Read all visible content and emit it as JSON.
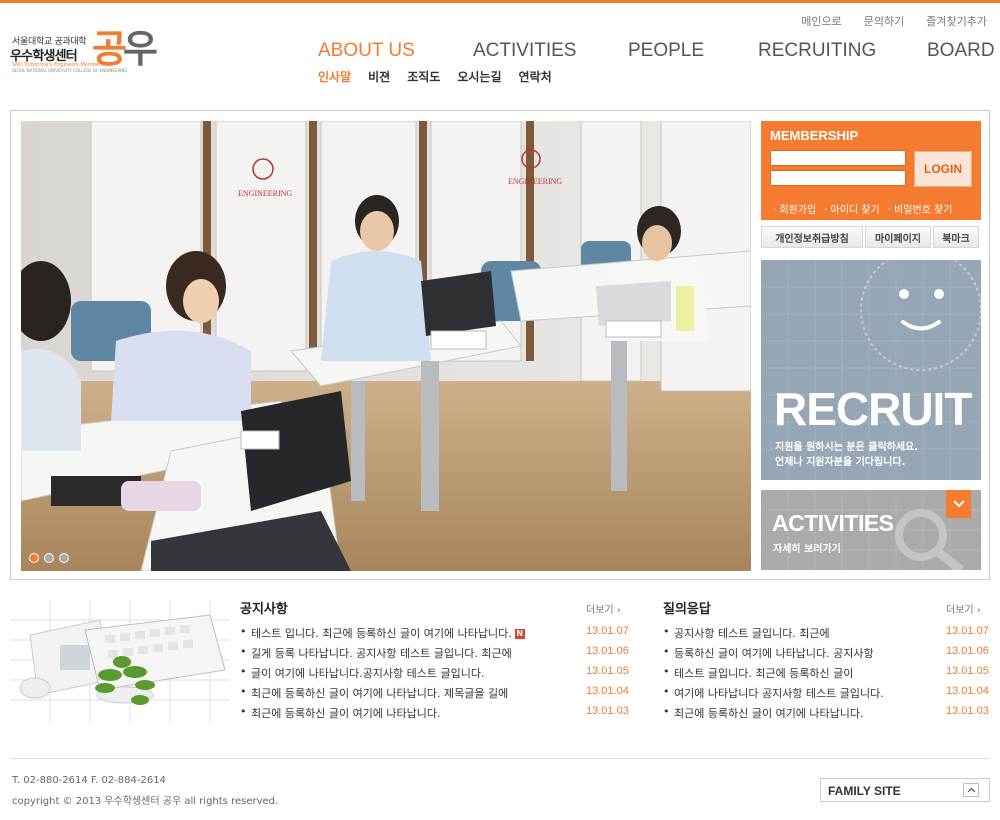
{
  "header": {
    "logo": {
      "line_small": "서울대학교 공과대학",
      "line_main": "우수학생센터",
      "line_en1": "SNU Tomorrow's Engineers Membership",
      "line_en2": "SEOUL NATIONAL UNIVERSITY COLLEGE OF ENGINEERING",
      "big_char1": "공",
      "big_char2": "우"
    },
    "util_links": [
      "메인으로",
      "문의하기",
      "즐겨찾기추가"
    ],
    "nav": [
      {
        "label": "ABOUT US",
        "active": true
      },
      {
        "label": "ACTIVITIES",
        "active": false
      },
      {
        "label": "PEOPLE",
        "active": false
      },
      {
        "label": "RECRUITING",
        "active": false
      },
      {
        "label": "BOARD",
        "active": false
      }
    ],
    "subnav": [
      {
        "label": "인사말",
        "active": true
      },
      {
        "label": "비젼",
        "active": false
      },
      {
        "label": "조직도",
        "active": false
      },
      {
        "label": "오시는길",
        "active": false
      },
      {
        "label": "연락처",
        "active": false
      }
    ]
  },
  "visual": {
    "signs": [
      "ENGINEERING",
      "ENGINEERING"
    ],
    "dots_count": 3,
    "active_dot": 0
  },
  "membership": {
    "title": "MEMBERSHIP",
    "id_value": "",
    "pw_value": "",
    "login_label": "LOGIN",
    "links": [
      "· 회원가입",
      "· 아이디 찾기",
      "· 비밀번호 찾기"
    ]
  },
  "quick_links": [
    "개인정보취급방침",
    "마이페이지",
    "북마크"
  ],
  "recruit_banner": {
    "title": "RECRUIT",
    "desc1": "지원을 원하시는 분은 클릭하세요.",
    "desc2": "언제나 지원자분을 기다립니다."
  },
  "activities_banner": {
    "title": "ACTIVITIES",
    "desc": "자세히 보러가기"
  },
  "notice": {
    "title": "공지사항",
    "more": "더보기 ›",
    "items": [
      {
        "subject": "테스트 입니다. 최근에 등록하신 글이 여기에 나타납니다.",
        "date": "13.01.07",
        "new": true
      },
      {
        "subject": "길게 등록 나타납니다. 공지사항 테스트 글입니다. 최근에",
        "date": "13.01.06",
        "new": false
      },
      {
        "subject": "글이 여기에 나타납니다.공지사항 테스트 글입니다.",
        "date": "13.01.05",
        "new": false
      },
      {
        "subject": "최근에 등록하신 글이 여기에 나타납니다. 제목글을 길에",
        "date": "13.01.04",
        "new": false
      },
      {
        "subject": "최근에 등록하신 글이 여기에 나타납니다.",
        "date": "13.01.03",
        "new": false
      }
    ],
    "new_badge": "N"
  },
  "qna": {
    "title": "질의응답",
    "more": "더보기 ›",
    "items": [
      {
        "subject": "공지사항 테스트 글입니다. 최근에",
        "date": "13.01.07"
      },
      {
        "subject": "등록하신 글이 여기에 나타납니다. 공지사항",
        "date": "13.01.06"
      },
      {
        "subject": "테스트 글입니다. 최근에 등록하신 글이",
        "date": "13.01.05"
      },
      {
        "subject": "여기에 나타납니다 공지사항 테스트 글입니다.",
        "date": "13.01.04"
      },
      {
        "subject": "최근에 등록하신 글이 여기에 나타납니다.",
        "date": "13.01.03"
      }
    ]
  },
  "footer": {
    "tel": "T. 02-880-2614 F. 02-884-2614",
    "copyright": "copyright © 2013 우수학생센터 공우 all rights reserved.",
    "family_site": "FAMILY SITE"
  },
  "colors": {
    "accent": "#f47b30",
    "recruit_bg": "#96a6b4",
    "activities_bg": "#aaaaaa"
  }
}
